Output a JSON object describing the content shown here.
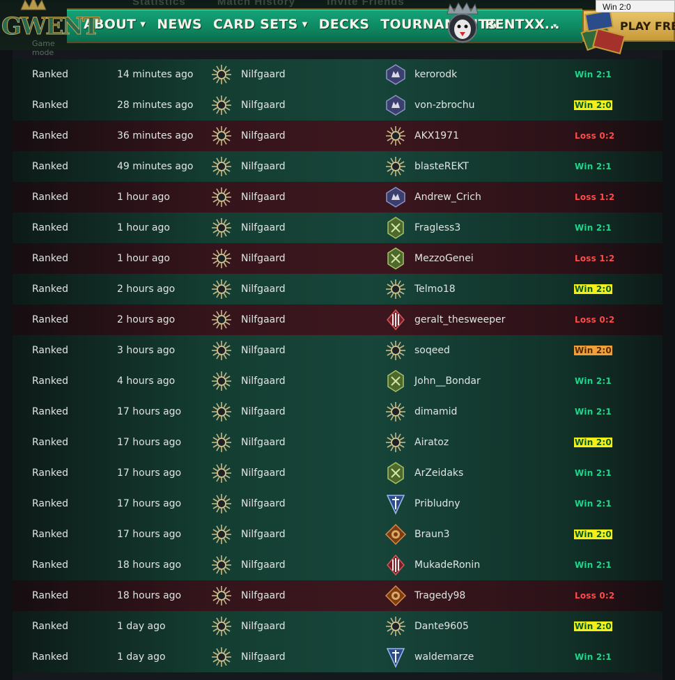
{
  "ghost_tabs": [
    "Statistics",
    "Match History",
    "Invite Friends"
  ],
  "logo": {
    "text": "GWENT",
    "subtitle": "Game mode"
  },
  "nav": {
    "items": [
      {
        "label": "About",
        "dropdown": true
      },
      {
        "label": "News",
        "dropdown": false
      },
      {
        "label": "Card Sets",
        "dropdown": true
      },
      {
        "label": "Decks",
        "dropdown": false
      },
      {
        "label": "Tournaments",
        "dropdown": false
      }
    ],
    "username": "RENTXX...",
    "user_caret": "▾",
    "play_free": "PLAY FREE"
  },
  "tooltip": "Win 2:0",
  "colors": {
    "accent": "#15a377",
    "win_text": "#1fd58e",
    "loss_text": "#ff4a4a",
    "highlight_yellow": "#f4ee1a",
    "highlight_orange": "#f0a03a"
  },
  "matches": [
    {
      "mode": "Ranked",
      "time": "14 minutes ago",
      "faction": "Nilfgaard",
      "opponent": "kerorodk",
      "opp_icon": "monsters",
      "result": "Win 2:1",
      "outcome": "win",
      "highlight": "none"
    },
    {
      "mode": "Ranked",
      "time": "28 minutes ago",
      "faction": "Nilfgaard",
      "opponent": "von-zbrochu",
      "opp_icon": "monsters",
      "result": "Win 2:0",
      "outcome": "win",
      "highlight": "yellow"
    },
    {
      "mode": "Ranked",
      "time": "36 minutes ago",
      "faction": "Nilfgaard",
      "opponent": "AKX1971",
      "opp_icon": "nilfgaard",
      "result": "Loss 0:2",
      "outcome": "loss",
      "highlight": "none"
    },
    {
      "mode": "Ranked",
      "time": "49 minutes ago",
      "faction": "Nilfgaard",
      "opponent": "blasteREKT",
      "opp_icon": "nilfgaard",
      "result": "Win 2:1",
      "outcome": "win",
      "highlight": "none"
    },
    {
      "mode": "Ranked",
      "time": "1 hour ago",
      "faction": "Nilfgaard",
      "opponent": "Andrew_Crich",
      "opp_icon": "monsters",
      "result": "Loss 1:2",
      "outcome": "loss",
      "highlight": "none"
    },
    {
      "mode": "Ranked",
      "time": "1 hour ago",
      "faction": "Nilfgaard",
      "opponent": "Fragless3",
      "opp_icon": "scoiatael",
      "result": "Win 2:1",
      "outcome": "win",
      "highlight": "none"
    },
    {
      "mode": "Ranked",
      "time": "1 hour ago",
      "faction": "Nilfgaard",
      "opponent": "MezzoGenei",
      "opp_icon": "scoiatael",
      "result": "Loss 1:2",
      "outcome": "loss",
      "highlight": "none"
    },
    {
      "mode": "Ranked",
      "time": "2 hours ago",
      "faction": "Nilfgaard",
      "opponent": "Telmo18",
      "opp_icon": "nilfgaard",
      "result": "Win 2:0",
      "outcome": "win",
      "highlight": "yellow"
    },
    {
      "mode": "Ranked",
      "time": "2 hours ago",
      "faction": "Nilfgaard",
      "opponent": "geralt_thesweeper",
      "opp_icon": "skellige",
      "result": "Loss 0:2",
      "outcome": "loss",
      "highlight": "none"
    },
    {
      "mode": "Ranked",
      "time": "3 hours ago",
      "faction": "Nilfgaard",
      "opponent": "soqeed",
      "opp_icon": "nilfgaard",
      "result": "Win 2:0",
      "outcome": "win",
      "highlight": "orange"
    },
    {
      "mode": "Ranked",
      "time": "4 hours ago",
      "faction": "Nilfgaard",
      "opponent": "John__Bondar",
      "opp_icon": "scoiatael",
      "result": "Win 2:1",
      "outcome": "win",
      "highlight": "none"
    },
    {
      "mode": "Ranked",
      "time": "17 hours ago",
      "faction": "Nilfgaard",
      "opponent": "dimamid",
      "opp_icon": "nilfgaard",
      "result": "Win 2:1",
      "outcome": "win",
      "highlight": "none"
    },
    {
      "mode": "Ranked",
      "time": "17 hours ago",
      "faction": "Nilfgaard",
      "opponent": "Airatoz",
      "opp_icon": "nilfgaard",
      "result": "Win 2:0",
      "outcome": "win",
      "highlight": "yellow"
    },
    {
      "mode": "Ranked",
      "time": "17 hours ago",
      "faction": "Nilfgaard",
      "opponent": "ArZeidaks",
      "opp_icon": "scoiatael",
      "result": "Win 2:1",
      "outcome": "win",
      "highlight": "none"
    },
    {
      "mode": "Ranked",
      "time": "17 hours ago",
      "faction": "Nilfgaard",
      "opponent": "Pribludny",
      "opp_icon": "northern-realms",
      "result": "Win 2:1",
      "outcome": "win",
      "highlight": "none"
    },
    {
      "mode": "Ranked",
      "time": "17 hours ago",
      "faction": "Nilfgaard",
      "opponent": "Braun3",
      "opp_icon": "syndicate",
      "result": "Win 2:0",
      "outcome": "win",
      "highlight": "yellow"
    },
    {
      "mode": "Ranked",
      "time": "18 hours ago",
      "faction": "Nilfgaard",
      "opponent": "MukadeRonin",
      "opp_icon": "skellige",
      "result": "Win 2:1",
      "outcome": "win",
      "highlight": "none"
    },
    {
      "mode": "Ranked",
      "time": "18 hours ago",
      "faction": "Nilfgaard",
      "opponent": "Tragedy98",
      "opp_icon": "syndicate",
      "result": "Loss 0:2",
      "outcome": "loss",
      "highlight": "none"
    },
    {
      "mode": "Ranked",
      "time": "1 day ago",
      "faction": "Nilfgaard",
      "opponent": "Dante9605",
      "opp_icon": "nilfgaard",
      "result": "Win 2:0",
      "outcome": "win",
      "highlight": "yellow"
    },
    {
      "mode": "Ranked",
      "time": "1 day ago",
      "faction": "Nilfgaard",
      "opponent": "waldemarze",
      "opp_icon": "northern-realms",
      "result": "Win 2:1",
      "outcome": "win",
      "highlight": "none"
    }
  ]
}
